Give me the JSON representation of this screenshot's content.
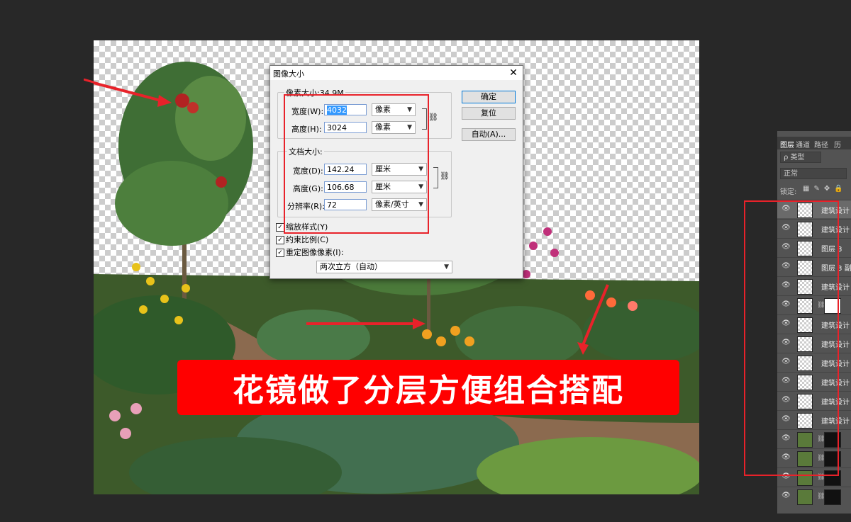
{
  "canvas": {
    "overlay_text": "花镜做了分层方便组合搭配"
  },
  "dialog": {
    "title": "图像大小",
    "close_glyph": "✕",
    "pixel_dims": {
      "label": "像素大小:34.9M",
      "width_label": "宽度(W):",
      "width_value": "4032",
      "width_unit": "像素",
      "height_label": "高度(H):",
      "height_value": "3024",
      "height_unit": "像素"
    },
    "doc_size": {
      "label": "文档大小:",
      "width_label": "宽度(D):",
      "width_value": "142.24",
      "width_unit": "厘米",
      "height_label": "高度(G):",
      "height_value": "106.68",
      "height_unit": "厘米",
      "res_label": "分辨率(R):",
      "res_value": "72",
      "res_unit": "像素/英寸"
    },
    "checkboxes": [
      {
        "label": "缩放样式(Y)",
        "checked": true
      },
      {
        "label": "约束比例(C)",
        "checked": true
      },
      {
        "label": "重定图像像素(I):",
        "checked": true
      }
    ],
    "resample_method": "两次立方（自动）",
    "buttons": {
      "ok": "确定",
      "reset": "复位",
      "auto": "自动(A)..."
    }
  },
  "layers_panel": {
    "tabs": [
      "图层",
      "通道",
      "路径",
      "历"
    ],
    "filter_label": "ρ 类型",
    "blend_mode": "正常",
    "lock_label": "锁定:",
    "layers": [
      {
        "name": "建筑设计",
        "thumb": "transparent",
        "mask": null,
        "active": true
      },
      {
        "name": "建筑设计",
        "thumb": "transparent",
        "mask": null,
        "active": false
      },
      {
        "name": "图层 3",
        "thumb": "transparent",
        "mask": null,
        "active": false
      },
      {
        "name": "图层 3 副",
        "thumb": "transparent",
        "mask": null,
        "active": false
      },
      {
        "name": "建筑设计",
        "thumb": "transparent",
        "mask": null,
        "active": false
      },
      {
        "name": "",
        "thumb": "transparent",
        "mask": "white",
        "active": false
      },
      {
        "name": "建筑设计",
        "thumb": "transparent",
        "mask": null,
        "active": false
      },
      {
        "name": "建筑设计",
        "thumb": "transparent",
        "mask": null,
        "active": false
      },
      {
        "name": "建筑设计",
        "thumb": "transparent",
        "mask": null,
        "active": false
      },
      {
        "name": "建筑设计",
        "thumb": "transparent",
        "mask": null,
        "active": false
      },
      {
        "name": "建筑设计",
        "thumb": "transparent",
        "mask": null,
        "active": false
      },
      {
        "name": "建筑设计",
        "thumb": "transparent",
        "mask": null,
        "active": false
      },
      {
        "name": "",
        "thumb": "image",
        "mask": "black",
        "active": false
      },
      {
        "name": "",
        "thumb": "image",
        "mask": "black",
        "active": false
      },
      {
        "name": "",
        "thumb": "image",
        "mask": "black",
        "active": false
      },
      {
        "name": "",
        "thumb": "image",
        "mask": "black",
        "active": false
      }
    ]
  },
  "colors": {
    "background": "#282828",
    "annotation_red": "#e8222a",
    "banner_red": "#ff0000"
  }
}
